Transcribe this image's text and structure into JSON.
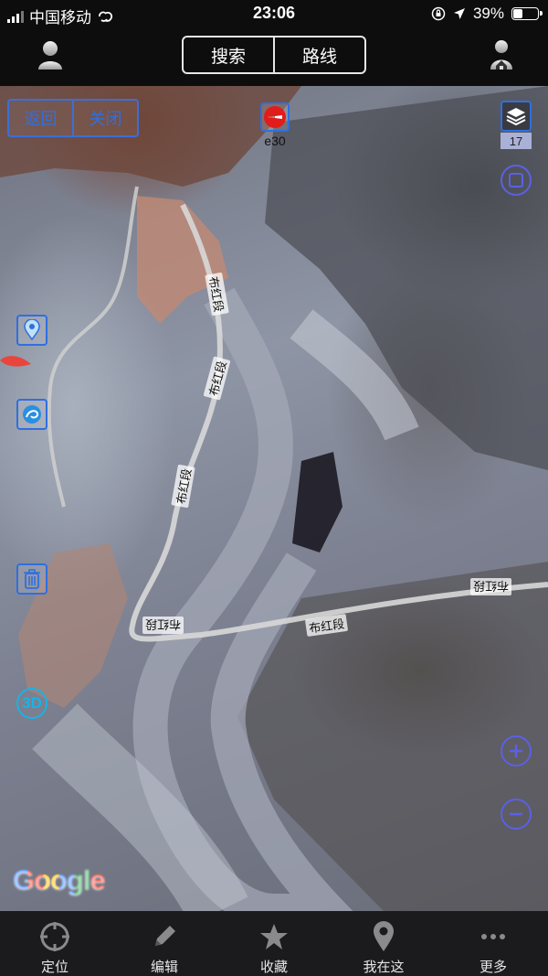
{
  "status": {
    "carrier": "中国移动",
    "time": "23:06",
    "battery": "39%",
    "battery_level": 0.39
  },
  "header": {
    "tabs": [
      {
        "label": "搜索"
      },
      {
        "label": "路线"
      }
    ]
  },
  "map": {
    "back_label": "返回",
    "close_label": "关闭",
    "compass_label": "e30",
    "zoom_level": "17",
    "mode_3d_label": "3D",
    "attribution": "Google",
    "road_labels": [
      "布红段",
      "布红段",
      "布红段",
      "布红段",
      "布红段"
    ]
  },
  "bottom_nav": [
    {
      "label": "定位",
      "icon": "crosshair-icon"
    },
    {
      "label": "编辑",
      "icon": "pencil-icon"
    },
    {
      "label": "收藏",
      "icon": "star-icon"
    },
    {
      "label": "我在这",
      "icon": "location-pin-icon"
    },
    {
      "label": "更多",
      "icon": "more-dots-icon"
    }
  ],
  "colors": {
    "accent_blue": "#2f6fe0",
    "circle_button": "#5b60e6",
    "badge_3d": "#19b3e6",
    "compass_red": "#e21b1b"
  }
}
